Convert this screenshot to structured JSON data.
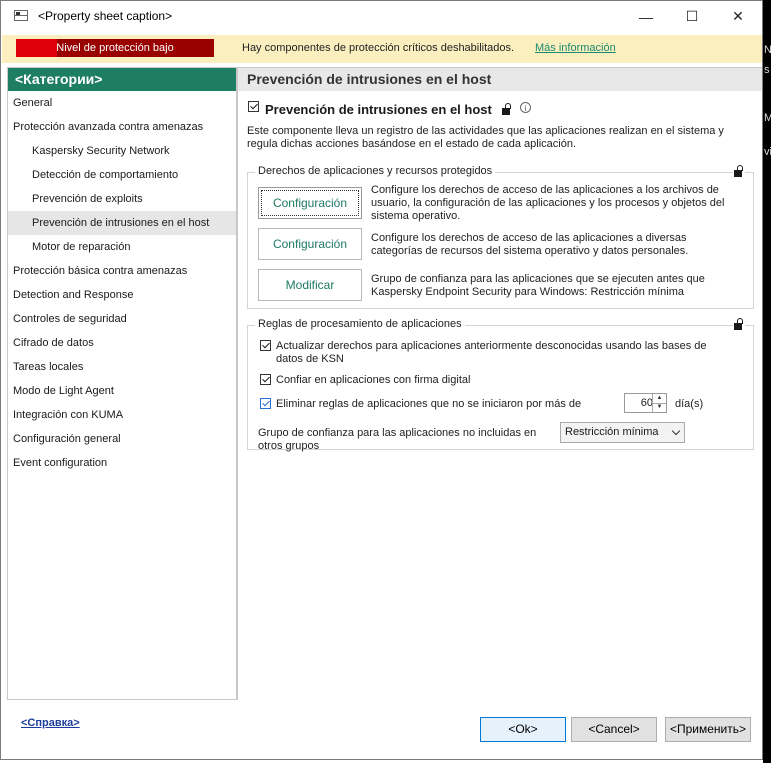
{
  "window": {
    "title": "<Property sheet caption>",
    "minimize_glyph": "—",
    "maximize_glyph": "☐",
    "close_glyph": "✕"
  },
  "warning_bar": {
    "protection_level": "Nivel de protección bajo",
    "message": "Hay componentes de protección críticos deshabilitados.",
    "link": "Más información",
    "colors": {
      "background": "#fbefc0",
      "level_red": "#e0000a",
      "level_dark": "#990000",
      "link": "#198a6f"
    }
  },
  "sidebar": {
    "header": "<Категории>",
    "header_color": "#1d7e62",
    "items": [
      {
        "label": "General",
        "indent": 0,
        "selected": false
      },
      {
        "label": "Protección avanzada contra amenazas",
        "indent": 0,
        "selected": false
      },
      {
        "label": "Kaspersky Security Network",
        "indent": 1,
        "selected": false
      },
      {
        "label": "Detección de comportamiento",
        "indent": 1,
        "selected": false
      },
      {
        "label": "Prevención de exploits",
        "indent": 1,
        "selected": false
      },
      {
        "label": "Prevención de intrusiones en el host",
        "indent": 1,
        "selected": true
      },
      {
        "label": "Motor de reparación",
        "indent": 1,
        "selected": false
      },
      {
        "label": "Protección básica contra amenazas",
        "indent": 0,
        "selected": false
      },
      {
        "label": "Detection and Response",
        "indent": 0,
        "selected": false
      },
      {
        "label": "Controles de seguridad",
        "indent": 0,
        "selected": false
      },
      {
        "label": "Cifrado de datos",
        "indent": 0,
        "selected": false
      },
      {
        "label": "Tareas locales",
        "indent": 0,
        "selected": false
      },
      {
        "label": "Modo de Light Agent",
        "indent": 0,
        "selected": false
      },
      {
        "label": "Integración con KUMA",
        "indent": 0,
        "selected": false
      },
      {
        "label": "Configuración general",
        "indent": 0,
        "selected": false
      },
      {
        "label": "Event configuration",
        "indent": 0,
        "selected": false
      }
    ]
  },
  "main": {
    "section_title": "Prevención de intrusiones en el host",
    "component": {
      "label": "Prevención de intrusiones en el host",
      "checked": true,
      "info_glyph": "i",
      "description_line1": "Este componente lleva un registro de las actividades que las aplicaciones realizan en el sistema y",
      "description_line2": "regula dichas acciones basándose en el estado de cada aplicación."
    },
    "rights_group": {
      "legend": "Derechos de aplicaciones y recursos protegidos",
      "rows": [
        {
          "button": "Configuración",
          "lines": [
            "Configure los derechos de acceso de las aplicaciones a los archivos de",
            "usuario, la configuración de las aplicaciones y los procesos y objetos del",
            "sistema operativo."
          ]
        },
        {
          "button": "Configuración",
          "lines": [
            "Configure los derechos de acceso de las aplicaciones a diversas",
            "categorías de recursos del sistema operativo y datos personales."
          ]
        },
        {
          "button": "Modificar",
          "lines": [
            "Grupo de confianza para las aplicaciones que se ejecuten antes que",
            "Kaspersky Endpoint Security para Windows: Restricción mínima"
          ]
        }
      ]
    },
    "rules_group": {
      "legend": "Reglas de procesamiento de aplicaciones",
      "update_rights": {
        "line1": "Actualizar derechos para aplicaciones anteriormente desconocidas usando las bases de",
        "line2": "datos de KSN",
        "checked": true
      },
      "trust_signed": {
        "label": "Confiar en aplicaciones con firma digital",
        "checked": true
      },
      "delete_rules": {
        "label": "Eliminar reglas de aplicaciones que no se iniciaron por más de",
        "checked": true
      },
      "days_value": "60",
      "days_unit": "día(s)",
      "trust_group_line1": "Grupo de confianza para las aplicaciones no incluidas en",
      "trust_group_line2": "otros grupos",
      "trust_group_value": "Restricción mínima"
    }
  },
  "footer": {
    "help_link": "<Справка>",
    "ok": "<Ok>",
    "cancel": "<Cancel>",
    "apply": "<Применить>"
  },
  "background_fragments": [
    "N",
    "s",
    "Ma",
    "vi"
  ]
}
